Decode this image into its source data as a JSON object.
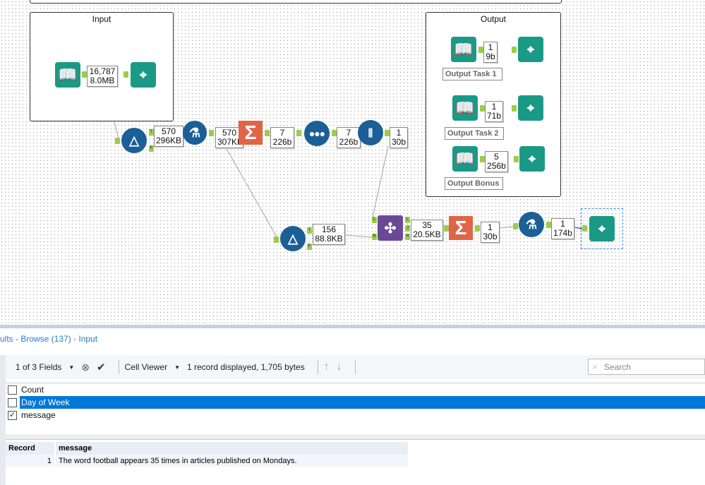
{
  "canvas": {
    "containers": {
      "input": "Input",
      "output": "Output"
    },
    "input_label": {
      "records": "16,787",
      "size": "8.0MB"
    },
    "filter1_label": {
      "records": "570",
      "size": "296KB"
    },
    "formula1_label": {
      "records": "570",
      "size": "307KB"
    },
    "summarize1_label": {
      "records": "7",
      "size": "226b"
    },
    "sample_label": {
      "records": "7",
      "size": "226b"
    },
    "multifield_label": {
      "records": "1",
      "size": "30b"
    },
    "filter2_label": {
      "records": "156",
      "size": "88.8KB"
    },
    "join_label": {
      "records": "35",
      "size": "20.5KB"
    },
    "summarize2_label": {
      "records": "1",
      "size": "30b"
    },
    "formula2_label": {
      "records": "1",
      "size": "174b"
    },
    "outputs": [
      {
        "records": "1",
        "size": "9b",
        "annotation": "Output Task 1"
      },
      {
        "records": "1",
        "size": "71b",
        "annotation": "Output Task 2"
      },
      {
        "records": "5",
        "size": "256b",
        "annotation": "Output Bonus"
      }
    ],
    "anchors": {
      "true": "T",
      "false": "F",
      "left": "L",
      "right": "R",
      "join": "J"
    },
    "icons": {
      "input": "book-icon",
      "browse": "binoculars-icon",
      "filter": "filter-icon",
      "formula": "flask-icon",
      "summarize": "sigma-icon",
      "sample": "dots-icon",
      "multifield": "test-tubes-icon",
      "join": "join-icon"
    },
    "colors": {
      "tool_blue": "#1b5f96",
      "tool_teal": "#1a9a86",
      "tool_orange": "#e06547",
      "tool_purple": "#6a4a96",
      "anchor": "#9ccc4a"
    }
  },
  "results": {
    "title": "ults - Browse (137) - Input",
    "fields_dropdown": "1 of 3 Fields",
    "viewer": "Cell Viewer",
    "status": "1 record displayed, 1,705 bytes",
    "search_placeholder": "Search",
    "fields": [
      {
        "name": "Count",
        "checked": false
      },
      {
        "name": "Day of Week",
        "checked": false,
        "selected": true
      },
      {
        "name": "message",
        "checked": true
      }
    ],
    "columns": [
      "Record",
      "message"
    ],
    "rows": [
      {
        "record": "1",
        "message": "The word football appears 35 times in articles published on Mondays."
      }
    ],
    "selection_color": "#0078d7"
  }
}
